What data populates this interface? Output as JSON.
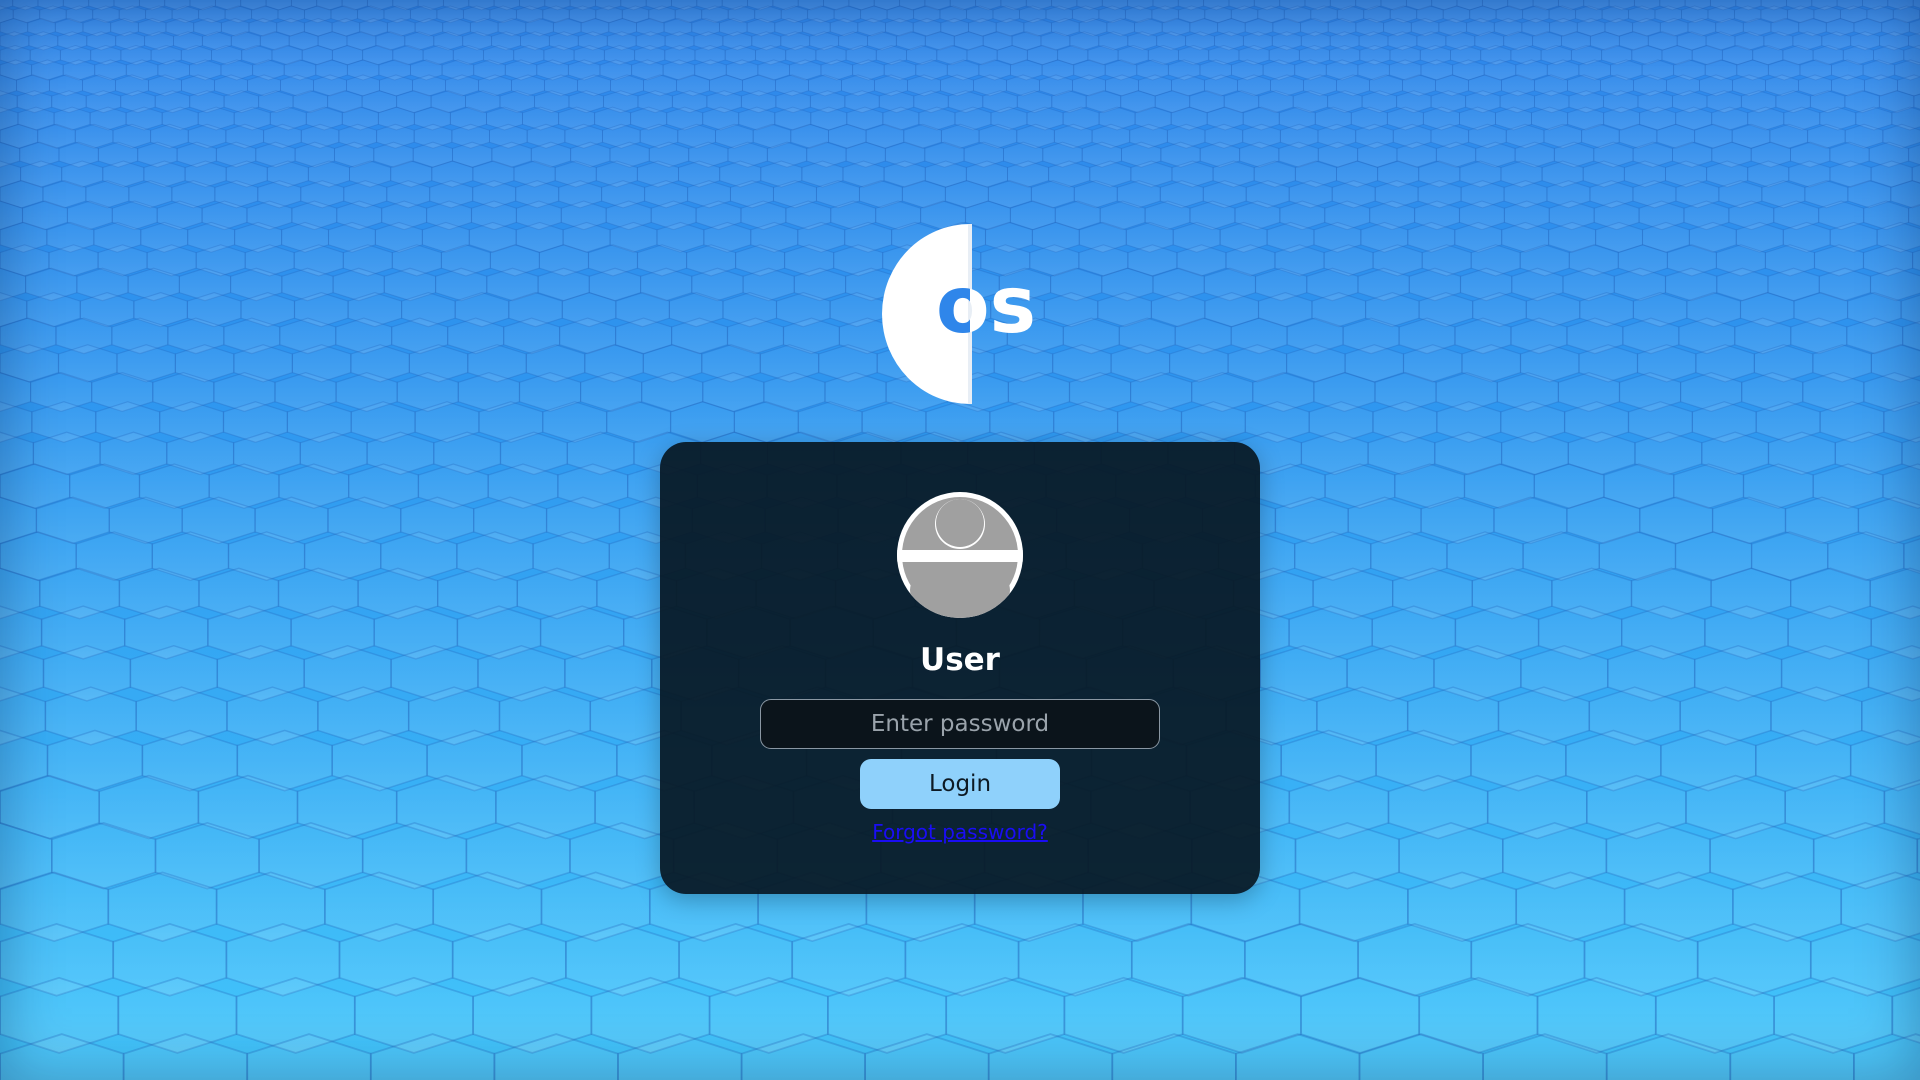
{
  "desktop": {
    "wallpaper_top_color": "#2f86ea",
    "wallpaper_bottom_color": "#43c6fb",
    "logo": {
      "text": "os",
      "icon": "os-logo-icon",
      "color": "#ffffff"
    }
  },
  "login": {
    "avatar_icon": "user-avatar-icon",
    "username": "User",
    "password_placeholder": "Enter password",
    "password_value": "",
    "login_label": "Login",
    "forgot_password_label": "Forgot password?",
    "card_color": "#08182a",
    "button_color": "#8fd1fb",
    "link_color": "#1a0df5"
  }
}
